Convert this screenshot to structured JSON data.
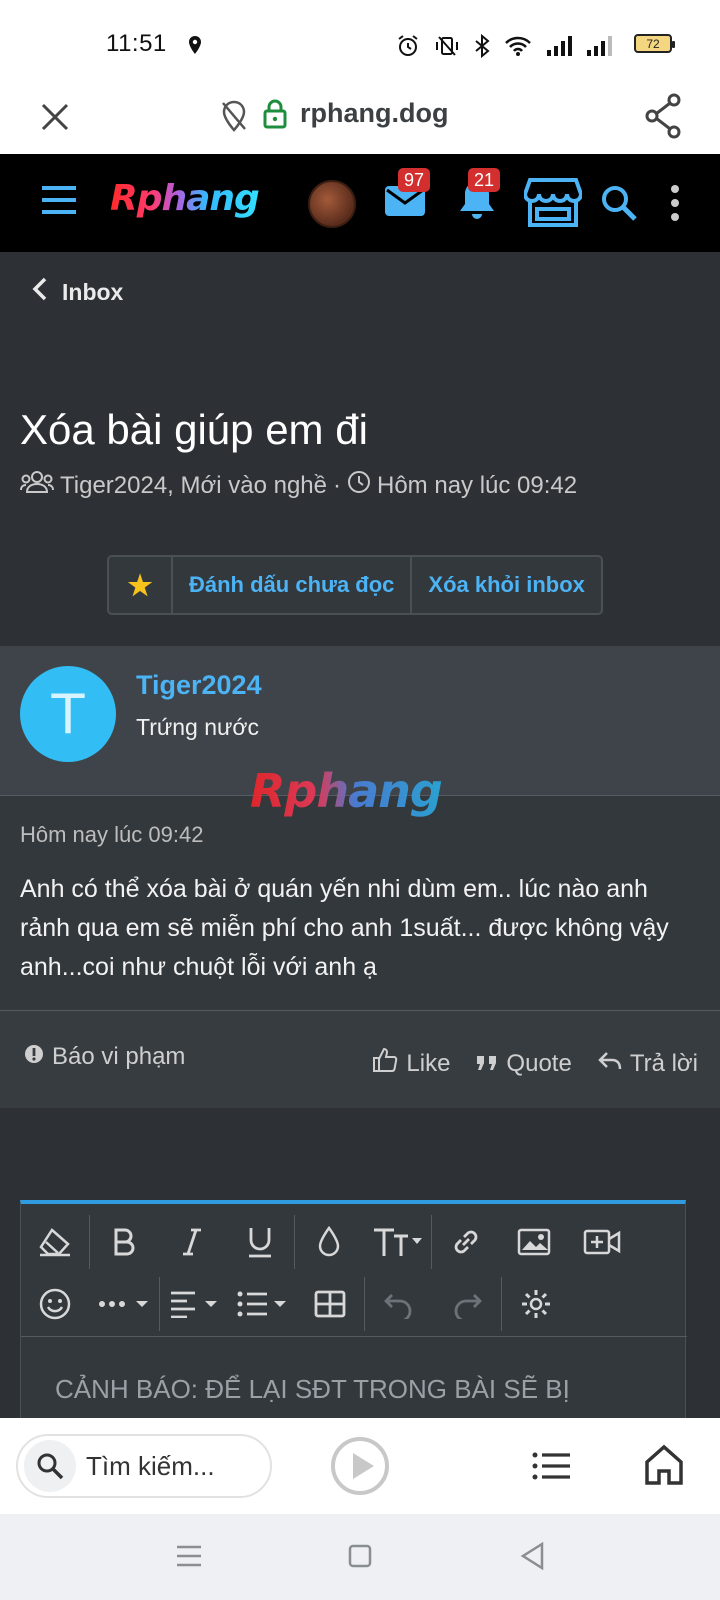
{
  "status_bar": {
    "time": "11:51",
    "battery": "72"
  },
  "url_bar": {
    "domain": "rphang.dog"
  },
  "site_header": {
    "logo": "Rphang",
    "inbox_badge": "97",
    "alerts_badge": "21"
  },
  "nav": {
    "back_label": "Inbox"
  },
  "conversation": {
    "title": "Xóa bài giúp em đi",
    "participants": "Tiger2024, Mới vào nghề",
    "separator": "·",
    "started": "Hôm nay lúc 09:42",
    "star": "★",
    "mark_unread": "Đánh dấu chưa đọc",
    "remove": "Xóa khỏi inbox"
  },
  "message": {
    "avatar_letter": "T",
    "author": "Tiger2024",
    "role": "Trứng nước",
    "watermark": "Rphang",
    "time": "Hôm nay lúc 09:42",
    "body": "Anh có thể xóa bài ở quán yến nhi dùm em.. lúc nào anh rảnh qua em sẽ miễn phí cho anh 1suất... được không vậy anh...coi như chuột lỗi với anh ạ",
    "report": "Báo vi phạm",
    "like": "Like",
    "quote": "Quote",
    "reply": "Trả lời"
  },
  "editor": {
    "placeholder": "CẢNH BÁO: ĐỂ LẠI SĐT TRONG BÀI SẼ BỊ"
  },
  "bottom_bar": {
    "search_placeholder": "Tìm kiếm..."
  },
  "colors": {
    "accent": "#4cb3f5",
    "background": "#2d3135",
    "badge": "#d32f2f",
    "avatar": "#33bdf5"
  }
}
